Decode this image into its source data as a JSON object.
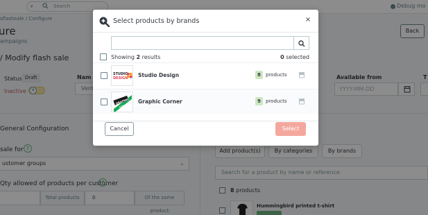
{
  "background": {
    "topbar": {
      "search_placeholder": "Search",
      "search_caret": "∨",
      "debug_text": "Debug mo"
    },
    "breadcrumb": "sflashsale  /  Configure",
    "page_title": "ure",
    "page_subtitle": "ampaigns",
    "back_button": "Back",
    "section_title": "/ Modify flash sale",
    "status_label": "Status",
    "status_badge": "Draft",
    "name_label": "Nam",
    "inactive_label": "Inactive",
    "toggle_x": "✕",
    "name_value": "Vent",
    "available_from_label": "Available from",
    "available_from_placeholder": "YYYY-MM-DD",
    "to_label": "T",
    "general_configuration": "General Configuration",
    "sale_for_label": "sale for",
    "help_glyph": "?",
    "customer_groups": "ustomer groups",
    "select_chevron": "⌄",
    "qty_label": "Qty allowed of products per customer",
    "total_products": "Total products",
    "qty_value": "0",
    "same_product": "Of the same product",
    "tabs": [
      "Add product(s)",
      "By categories",
      "By brands"
    ],
    "product_search_placeholder": "Search for a product by name or reference",
    "products_count_label": "products",
    "products_count": "8",
    "tshirt_name": "Hummingbird printed t-shirt"
  },
  "modal": {
    "title": "Select products by brands",
    "close_icon": "×",
    "search_value": "",
    "showing_prefix": "Showing ",
    "showing_count": "2",
    "showing_suffix": " results",
    "selected_count": "0",
    "selected_suffix": " selected",
    "brands": [
      {
        "name": "Studio Design",
        "count": "8",
        "count_label": "products",
        "logo": "studio-design-logo"
      },
      {
        "name": "Graphic Corner",
        "count": "9",
        "count_label": "products",
        "logo": "graphic-corner-logo"
      }
    ],
    "cancel_label": "Cancel",
    "select_label": "Select"
  },
  "logos": {
    "studio_line1": "STUDIO",
    "studio_line2": "DESIGN",
    "graphic_line1": "GRAPHIC",
    "graphic_line2": "CORNER"
  },
  "colors": {
    "accent_green": "#70b580",
    "select_button": "#f4a89d",
    "count_badge": "#cde8c2",
    "inactive_red": "#c05c67"
  }
}
